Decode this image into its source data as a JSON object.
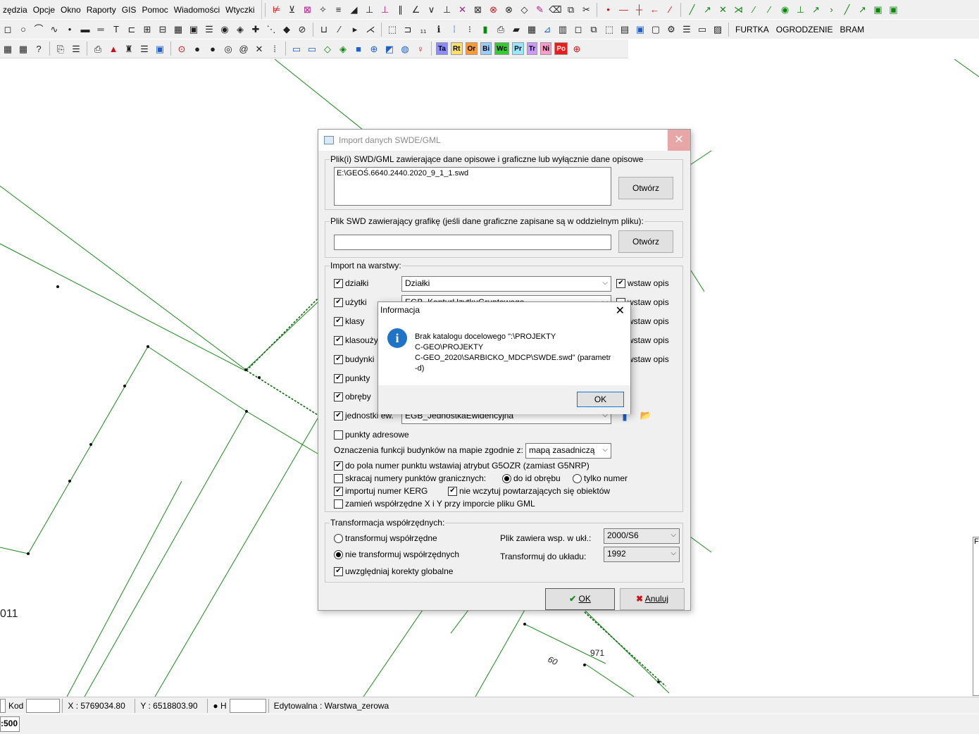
{
  "menu": [
    "zędzia",
    "Opcje",
    "Okno",
    "Raporty",
    "GIS",
    "Pomoc",
    "Wiadomości",
    "Wtyczki"
  ],
  "toolbar": {
    "row1_icons": [
      "polyline-tool-icon",
      "polygon-tool-icon",
      "area-tool-icon",
      "hatch-tool-icon",
      "line-style-icon",
      "fill-icon",
      "perpendicular-icon",
      "foot-icon",
      "parallel-icon",
      "angle-icon",
      "angle-2-icon",
      "perpendicular-2-icon",
      "cross-icon",
      "square-cross-icon",
      "rotate-icon",
      "rotate-2-icon",
      "diamond-icon",
      "pencil-icon",
      "eraser-icon",
      "map-icon",
      "scissors-icon"
    ],
    "row1_glyphs": [
      "⊭",
      "⊻",
      "⊠",
      "✧",
      "≡",
      "◢",
      "⊥",
      "⊥",
      "∥",
      "∠",
      "∨",
      "⊥",
      "✕",
      "⊠",
      "⊗",
      "⊗",
      "◇",
      "✎",
      "⌫",
      "⧉",
      "✂"
    ],
    "row1_snap_glyphs": [
      "•",
      "—",
      "┼",
      "←",
      "⁄"
    ],
    "row1_snap_icons": [
      "snap-point-icon",
      "snap-line-icon",
      "snap-cross-icon",
      "snap-arrow-icon",
      "snap-slash-icon"
    ],
    "row1_edit_glyphs": [
      "╱",
      "↗",
      "✕",
      "⋊",
      "⁄",
      "⁄",
      "◉",
      "⊥",
      "↗",
      "›",
      "╱",
      "↗",
      "▣",
      "▣"
    ],
    "row1_edit_icons": [
      "edit-line-icon",
      "edit-arrow-icon",
      "edit-cross-icon",
      "edit-split-icon",
      "edit-slash-icon",
      "edit-slash-2-icon",
      "edit-circle-icon",
      "edit-perp-icon",
      "edit-arrow-2-icon",
      "edit-chevron-icon",
      "edit-line-2-icon",
      "edit-arrow-3-icon",
      "layer-add-icon",
      "layer-remove-icon"
    ],
    "row2_glyphs": [
      "◻",
      "○",
      "⌒",
      "∿",
      "•",
      "▬",
      "═",
      "T",
      "⊏",
      "⊞",
      "⊟",
      "▦",
      "▣",
      "☰",
      "◉",
      "◈",
      "✚",
      "⋱",
      "◆",
      "⊘",
      "⊔",
      "⁄",
      "▸",
      "⋌"
    ],
    "row2_icons": [
      "rectangle-icon",
      "circle-icon",
      "arc-icon",
      "curve-icon",
      "point-icon",
      "bar-icon",
      "double-line-icon",
      "text-icon",
      "label-icon",
      "table-icon",
      "table-2-icon",
      "grid-icon",
      "image-icon",
      "list-icon",
      "target-icon",
      "marker-icon",
      "crosshair-icon",
      "dots-icon",
      "diamond-fill-icon",
      "no-icon",
      "bucket-icon",
      "pen-icon",
      "select-arrow-icon",
      "zoom-icon"
    ],
    "row2b_glyphs": [
      "⬚",
      "⊐",
      "₁₁",
      "ℹ",
      "⁞",
      "⁝",
      "▮",
      "⎙",
      "▰",
      "▦",
      "⊿",
      "▥",
      "◻",
      "⧉",
      "⬚",
      "▤",
      "▣",
      "▢",
      "⚙",
      "☰",
      "▭",
      "▨"
    ],
    "row2b_icons": [
      "frame-icon",
      "frame-2-icon",
      "numbers-icon",
      "info-icon",
      "vertical-dots-icon",
      "vertical-dots-2-icon",
      "bar-chart-icon",
      "print-icon",
      "layers-icon",
      "grid-2-icon",
      "measure-icon",
      "table-3-icon",
      "window-icon",
      "window-2-icon",
      "frame-3-icon",
      "list-2-icon",
      "box-icon",
      "box-2-icon",
      "settings-icon",
      "menu-icon",
      "panel-icon",
      "panel-2-icon"
    ],
    "row2_text_buttons": [
      "FURTKA",
      "OGRODZENIE",
      "BRAM"
    ],
    "row3_glyphs": [
      "▦",
      "▦",
      "?",
      "⎘",
      "☰",
      "⎙",
      "▲",
      "♜",
      "☰",
      "▣",
      "⊙",
      "●",
      "●",
      "◎",
      "@",
      "✕",
      "⁞"
    ],
    "row3_icons": [
      "grid-3-icon",
      "grid-4-icon",
      "help-icon",
      "copy-icon",
      "list-3-icon",
      "print-2-icon",
      "mountain-icon",
      "tower-icon",
      "list-4-icon",
      "square-icon",
      "target-2-icon",
      "dot-icon",
      "dot-2-icon",
      "globe-icon",
      "at-icon",
      "close-2-icon",
      "dots-2-icon"
    ],
    "row3b_glyphs": [
      "▭",
      "▭",
      "◇",
      "◈",
      "■",
      "⊕",
      "◩",
      "◍",
      "♀"
    ],
    "row3b_icons": [
      "wms-icon",
      "kl-icon",
      "diamond-2-icon",
      "diamond-3-icon",
      "square-2-icon",
      "globe-2-icon",
      "layer-icon",
      "globe-3-icon",
      "pin-icon"
    ],
    "row3_labels": [
      "Ta",
      "Rt",
      "Or",
      "Bi",
      "Wc",
      "Pr",
      "Tr",
      "Ni",
      "Po"
    ],
    "row3_label_colors": [
      "#8c8cff",
      "#ffe066",
      "#ff9933",
      "#99ccff",
      "#33cc33",
      "#99e6ff",
      "#cc99ff",
      "#ff99cc",
      "#e61e1e"
    ]
  },
  "map_labels": {
    "parcel_011": "011",
    "parcel_971": "971",
    "dim_60": "60"
  },
  "status": {
    "kod_label": "Kod",
    "x_coord": "X : 5769034.80",
    "y_coord": "Y : 6518803.90",
    "h_label": "● H",
    "layer": "Edytowalna : Warstwa_zerowa",
    "scale": ":500"
  },
  "dialog": {
    "title": "Import danych SWDE/GML",
    "close": "✕",
    "files_group": "Plik(i) SWD/GML zawierające dane opisowe i graficzne lub wyłącznie dane opisowe",
    "files_value": "E:\\GEOŚ.6640.2440.2020_9_1_1.swd",
    "open_button": "Otwórz",
    "graphics_group": "Plik SWD zawierający grafikę (jeśli dane graficzne zapisane są w oddzielnym pliku):",
    "graphics_value": "",
    "open_button2": "Otwórz",
    "layers_group": "Import na warstwy:",
    "layers": [
      {
        "label": "działki",
        "combo": "Działki",
        "opis": "wstaw opis"
      },
      {
        "label": "użytki",
        "combo": "EGB_KonturUzytkuGruntowego",
        "opis": "wstaw opis"
      },
      {
        "label": "klasy",
        "combo": "",
        "opis": "wstaw opis"
      },
      {
        "label": "klasoużytki",
        "combo": "",
        "opis": "wstaw opis"
      },
      {
        "label": "budynki",
        "combo": "",
        "opis": "wstaw opis"
      },
      {
        "label": "punkty",
        "combo": "",
        "opis": ""
      },
      {
        "label": "obręby",
        "combo": "",
        "opis": ""
      },
      {
        "label": "jednostki ew.",
        "combo": "EGB_JednostkaEwidencyjna",
        "opis": ""
      }
    ],
    "punkty_adresowe": "punkty adresowe",
    "oznaczenia_label": "Oznaczenia funkcji budynków na mapie zgodnie z:",
    "oznaczenia_value": "mapą zasadniczą",
    "g5ozr": "do pola numer punktu wstawiaj atrybut G5OZR (zamiast G5NRP)",
    "skracaj": "skracaj numery punktów granicznych:",
    "radio_obreb": "do id obrębu",
    "radio_numer": "tylko numer",
    "kerg": "importuj numer KERG",
    "powtarzajace": "nie wczytuj powtarzających się obiektów",
    "zamien": "zamień współrzędne X i Y przy imporcie pliku GML",
    "transform_group": "Transformacja współrzędnych:",
    "transformuj": "transformuj współrzędne",
    "nie_transformuj": "nie transformuj współrzędnych",
    "korekty": "uwzględniaj korekty globalne",
    "plik_zawiera_label": "Plik zawiera wsp. w ukł.:",
    "plik_zawiera_value": "2000/S6",
    "transformuj_do_label": "Transformuj do układu:",
    "transformuj_do_value": "1992",
    "ok": "OK",
    "anuluj": "Anuluj"
  },
  "info": {
    "title": "Informacja",
    "message": "Brak katalogu docelowego \":\\PROJEKTY\nC-GEO\\PROJEKTY\nC-GEO_2020\\SARBICKO_MDCP\\SWDE.swd\" (parametr\n-d)",
    "ok": "OK",
    "close": "✕"
  },
  "edge_panel": "F"
}
